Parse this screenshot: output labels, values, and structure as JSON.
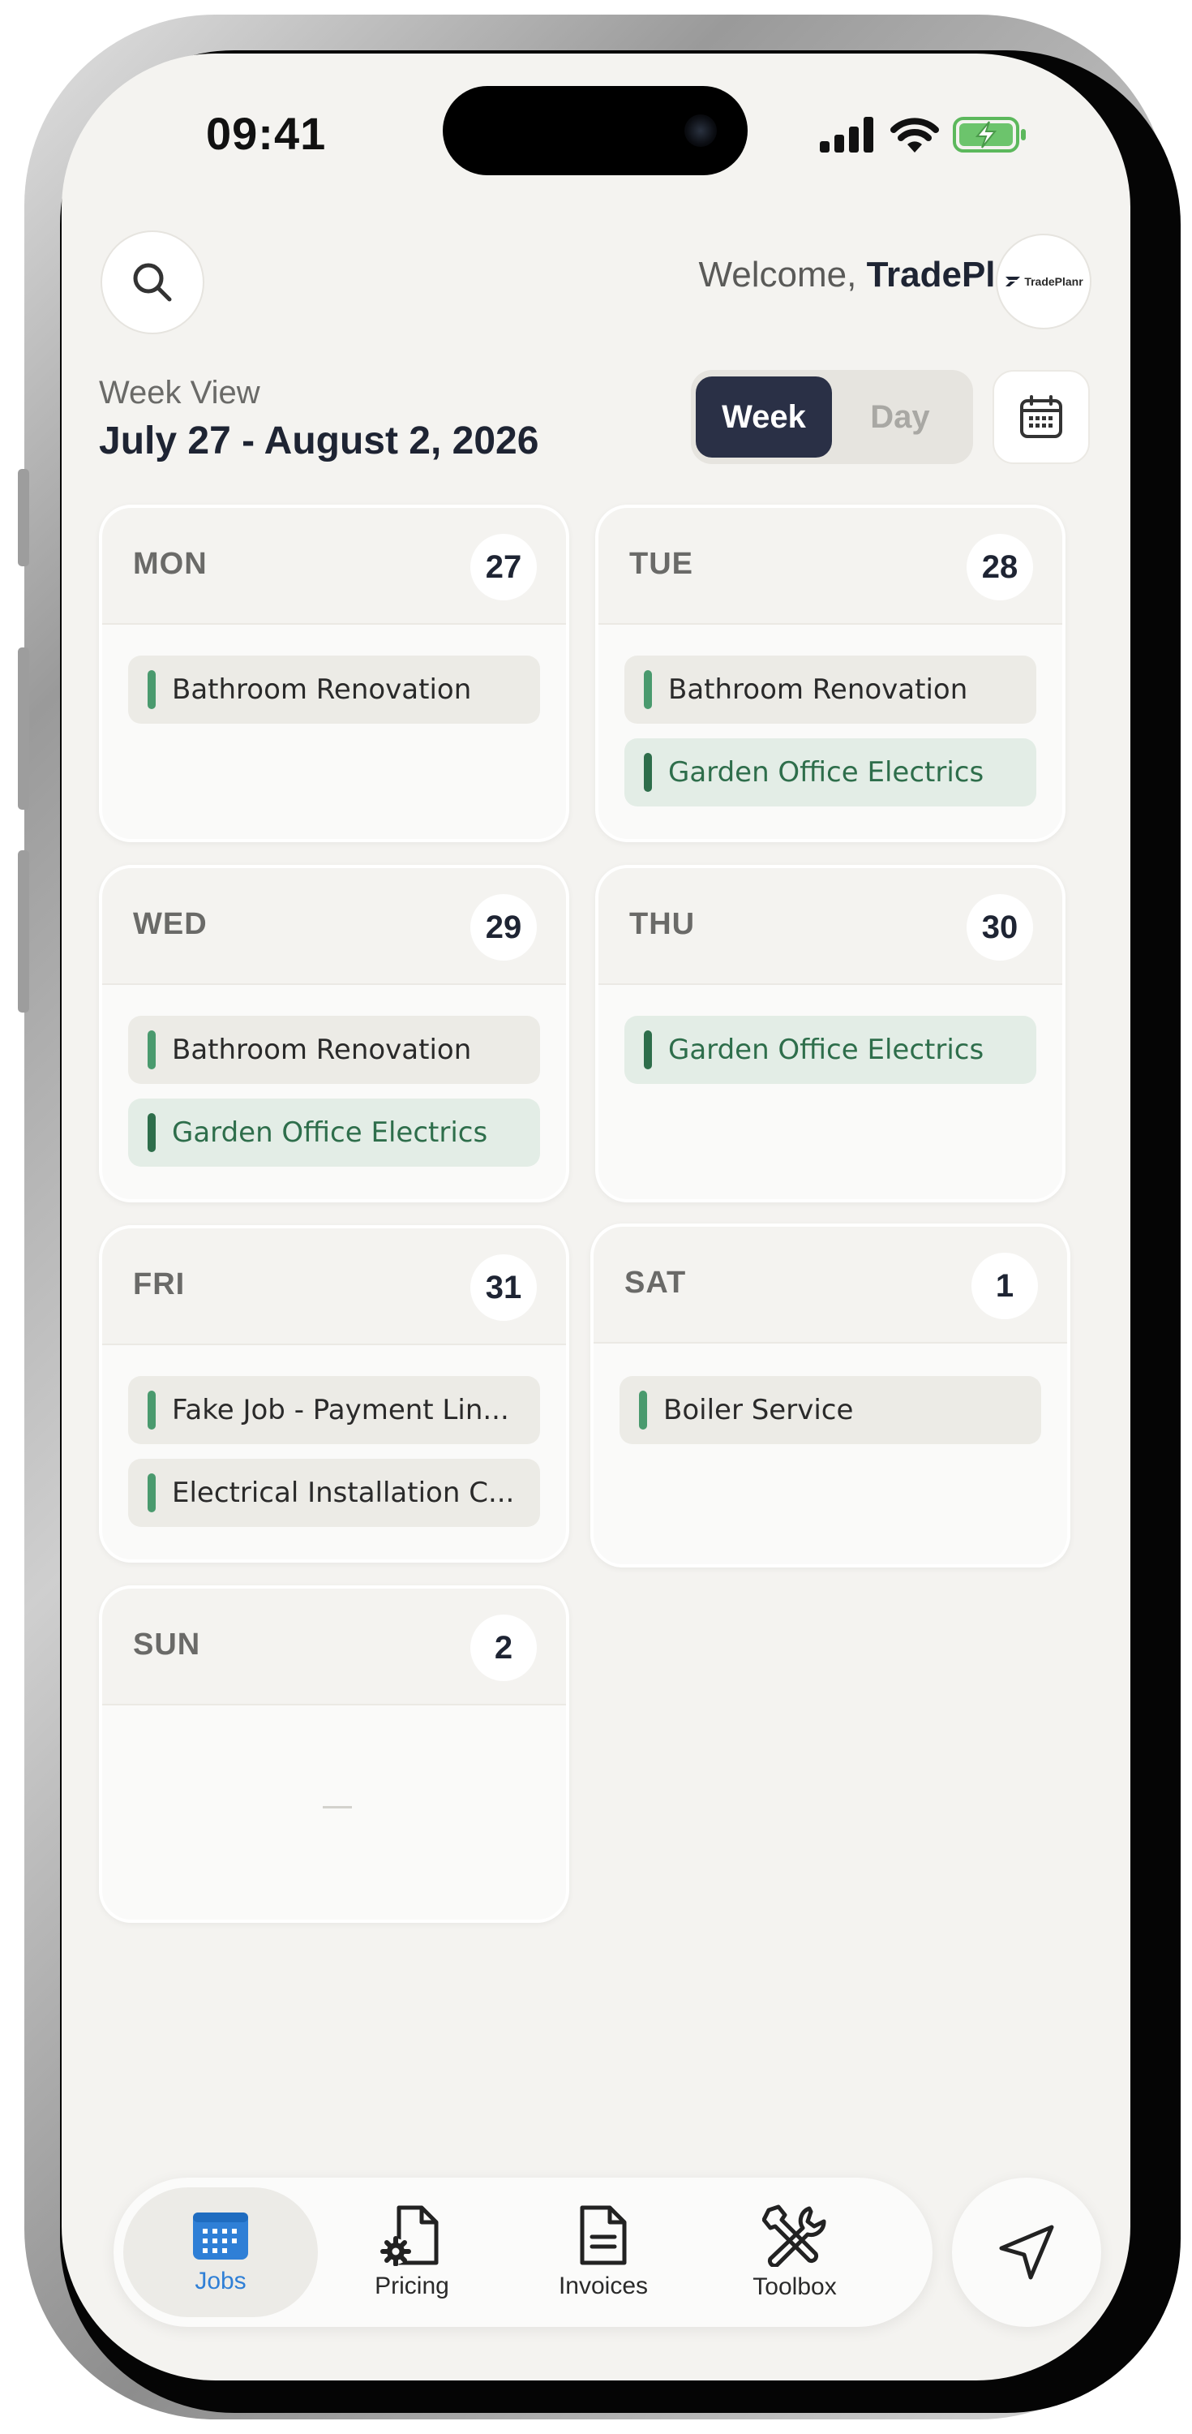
{
  "status_bar": {
    "time": "09:41"
  },
  "header": {
    "welcome_prefix": "Welcome, ",
    "user_name": "TradePlanr",
    "logo_text": "TradePlanr",
    "view_label": "Week View",
    "date_range": "July 27 - August 2, 2026"
  },
  "view_toggle": {
    "week_label": "Week",
    "day_label": "Day",
    "selected": "Week"
  },
  "days": [
    {
      "name": "MON",
      "num": "27",
      "jobs": [
        {
          "title": "Bathroom Renovation",
          "style": "default"
        }
      ]
    },
    {
      "name": "TUE",
      "num": "28",
      "jobs": [
        {
          "title": "Bathroom Renovation",
          "style": "default"
        },
        {
          "title": "Garden Office Electrics",
          "style": "green"
        }
      ]
    },
    {
      "name": "WED",
      "num": "29",
      "jobs": [
        {
          "title": "Bathroom Renovation",
          "style": "default"
        },
        {
          "title": "Garden Office Electrics",
          "style": "green"
        }
      ]
    },
    {
      "name": "THU",
      "num": "30",
      "jobs": [
        {
          "title": "Garden Office Electrics",
          "style": "green"
        }
      ]
    },
    {
      "name": "FRI",
      "num": "31",
      "jobs": [
        {
          "title": "Fake Job - Payment Lin...",
          "style": "default"
        },
        {
          "title": "Electrical Installation C...",
          "style": "default"
        }
      ]
    },
    {
      "name": "SAT",
      "num": "1",
      "jobs": [
        {
          "title": "Boiler Service",
          "style": "default"
        }
      ]
    },
    {
      "name": "SUN",
      "num": "2",
      "jobs": [],
      "empty_text": "—"
    }
  ],
  "nav": {
    "items": [
      {
        "label": "Jobs",
        "icon": "calendar-icon",
        "active": true
      },
      {
        "label": "Pricing",
        "icon": "document-gear-icon",
        "active": false
      },
      {
        "label": "Invoices",
        "icon": "invoice-icon",
        "active": false
      },
      {
        "label": "Toolbox",
        "icon": "tools-icon",
        "active": false
      }
    ],
    "send_icon": "send-icon"
  },
  "colors": {
    "background": "#f4f3f0",
    "primary_dark": "#2a3046",
    "accent_blue": "#2f7fd6",
    "job_green": "#4a9a6e",
    "job_green_dark": "#2e6e4b",
    "battery_green": "#5cb85c"
  }
}
